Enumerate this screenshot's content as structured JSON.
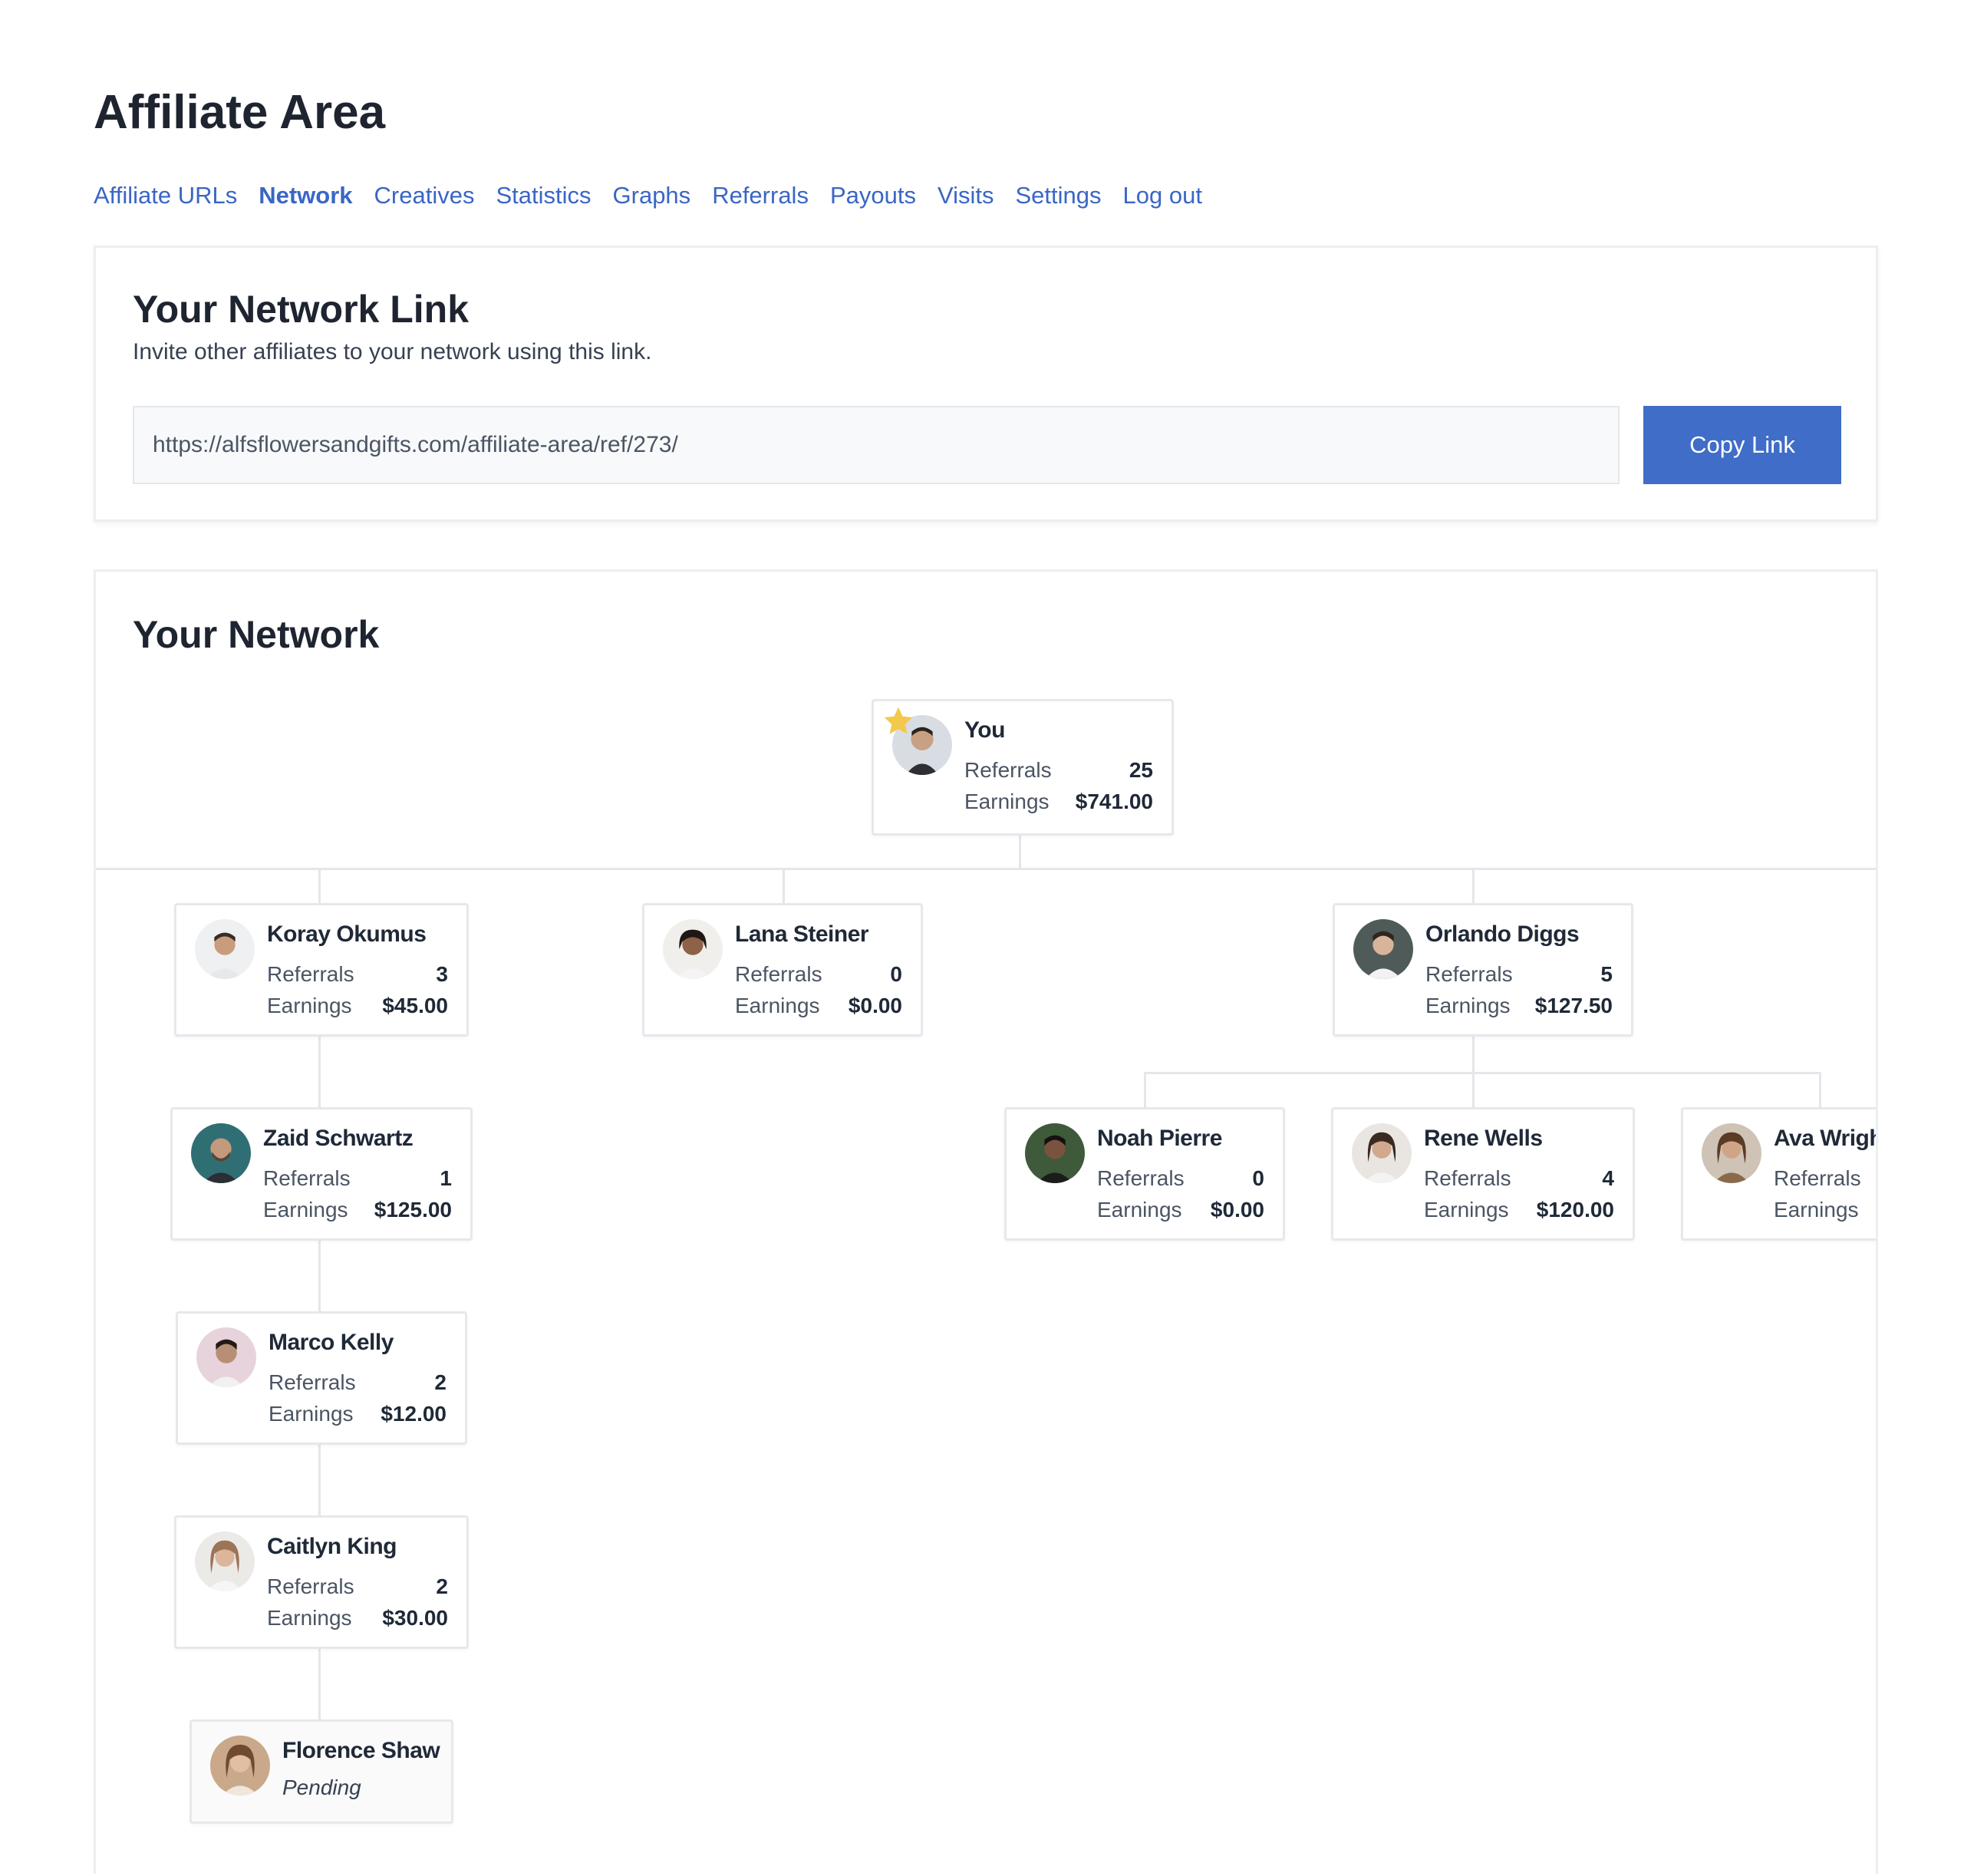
{
  "page": {
    "title": "Affiliate Area"
  },
  "nav": {
    "items": [
      {
        "label": "Affiliate URLs"
      },
      {
        "label": "Network"
      },
      {
        "label": "Creatives"
      },
      {
        "label": "Statistics"
      },
      {
        "label": "Graphs"
      },
      {
        "label": "Referrals"
      },
      {
        "label": "Payouts"
      },
      {
        "label": "Visits"
      },
      {
        "label": "Settings"
      },
      {
        "label": "Log out"
      }
    ],
    "active": "Network"
  },
  "network_link": {
    "title": "Your Network Link",
    "subtitle": "Invite other affiliates to your network using this link.",
    "url": "https://alfsflowersandgifts.com/affiliate-area/ref/273/",
    "copy_label": "Copy Link"
  },
  "network": {
    "title": "Your Network",
    "referrals_label": "Referrals",
    "earnings_label": "Earnings",
    "root": {
      "name": "You",
      "referrals": "25",
      "earnings": "$741.00",
      "icon": "star-icon"
    },
    "members": [
      {
        "name": "Koray Okumus",
        "referrals": "3",
        "earnings": "$45.00"
      },
      {
        "name": "Lana Steiner",
        "referrals": "0",
        "earnings": "$0.00"
      },
      {
        "name": "Orlando Diggs",
        "referrals": "5",
        "earnings": "$127.50"
      },
      {
        "name": "Zaid Schwartz",
        "referrals": "1",
        "earnings": "$125.00"
      },
      {
        "name": "Noah Pierre",
        "referrals": "0",
        "earnings": "$0.00"
      },
      {
        "name": "Rene Wells",
        "referrals": "4",
        "earnings": "$120.00"
      },
      {
        "name": "Ava Wright",
        "referrals": "",
        "earnings": "$"
      },
      {
        "name": "Marco Kelly",
        "referrals": "2",
        "earnings": "$12.00"
      },
      {
        "name": "Caitlyn King",
        "referrals": "2",
        "earnings": "$30.00"
      }
    ],
    "pending": {
      "name": "Florence Shaw",
      "status": "Pending"
    }
  },
  "colors": {
    "accent": "#3f6dc7",
    "link": "#3a66c4",
    "star": "#f2c94c"
  }
}
